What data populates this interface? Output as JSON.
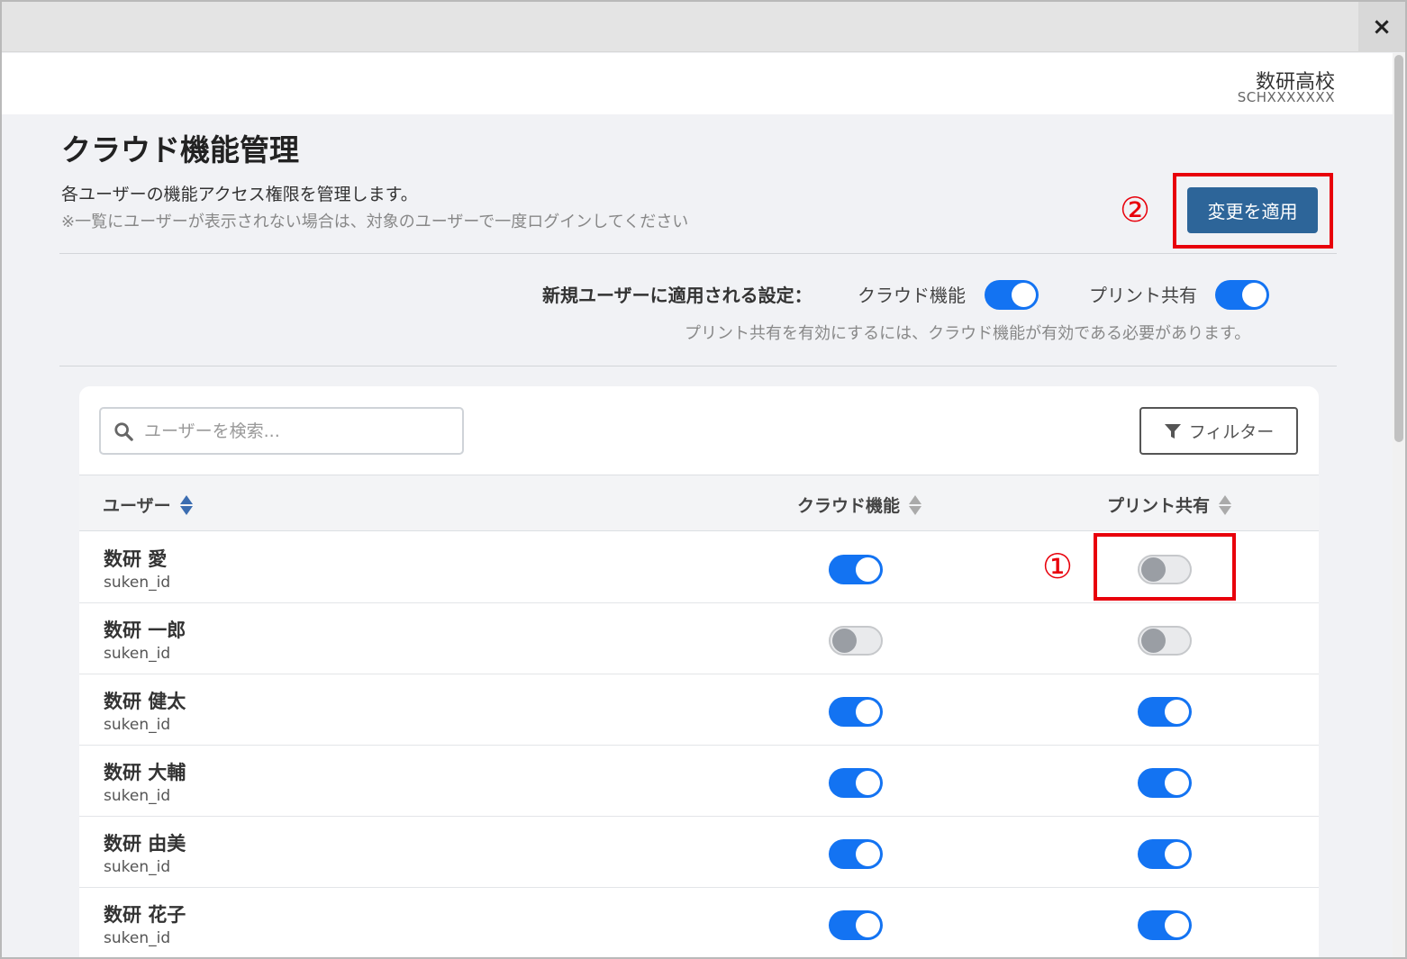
{
  "window": {
    "close_label": "×"
  },
  "org": {
    "name": "数研高校",
    "code": "SCHXXXXXXX"
  },
  "page": {
    "title": "クラウド機能管理",
    "description": "各ユーザーの機能アクセス権限を管理します。",
    "note": "※一覧にユーザーが表示されない場合は、対象のユーザーで一度ログインしてください"
  },
  "actions": {
    "apply_label": "変更を適用"
  },
  "annotations": {
    "marker_1": "①",
    "marker_2": "②",
    "highlight_color": "#e8000b"
  },
  "defaults": {
    "label": "新規ユーザーに適用される設定：",
    "cloud_label": "クラウド機能",
    "cloud_on": true,
    "print_label": "プリント共有",
    "print_on": true,
    "note": "プリント共有を有効にするには、クラウド機能が有効である必要があります。"
  },
  "search": {
    "placeholder": "ユーザーを検索..."
  },
  "filter": {
    "label": "フィルター"
  },
  "table": {
    "headers": {
      "user": "ユーザー",
      "cloud": "クラウド機能",
      "print": "プリント共有"
    },
    "rows": [
      {
        "name": "数研 愛",
        "id": "suken_id",
        "cloud": true,
        "print": false
      },
      {
        "name": "数研 一郎",
        "id": "suken_id",
        "cloud": false,
        "print": false
      },
      {
        "name": "数研 健太",
        "id": "suken_id",
        "cloud": true,
        "print": true
      },
      {
        "name": "数研 大輔",
        "id": "suken_id",
        "cloud": true,
        "print": true
      },
      {
        "name": "数研 由美",
        "id": "suken_id",
        "cloud": true,
        "print": true
      },
      {
        "name": "数研 花子",
        "id": "suken_id",
        "cloud": true,
        "print": true
      }
    ]
  },
  "colors": {
    "primary": "#2d6599",
    "toggle_on": "#1373f2",
    "toggle_off": "#e9eaec"
  }
}
